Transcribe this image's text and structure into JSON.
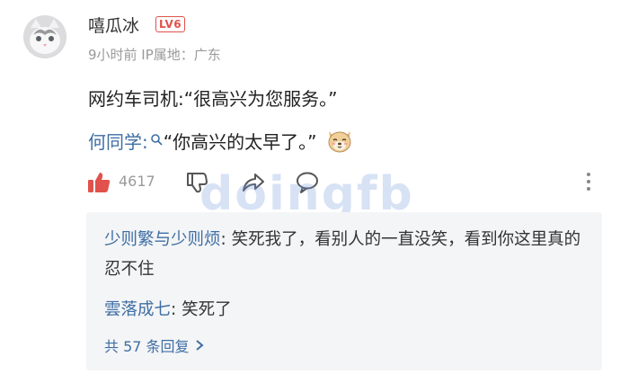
{
  "comment": {
    "username": "嘻瓜冰",
    "level_badge": "LV6",
    "meta": "9小时前 IP属地：广东",
    "line1": "网约车司机:“很高兴为您服务。”",
    "line2_mention": "何同学:",
    "line2_text": "“你高兴的太早了。”",
    "likes": "4617"
  },
  "watermark": "doingfb",
  "replies": {
    "reply1_name": "少则繁与少则烦",
    "reply1_text": ": 笑死我了，看别人的一直没笑，看到你这里真的忍不住",
    "reply2_name": "雲落成七",
    "reply2_text": ": 笑死了",
    "more_label": "共 57 条回复"
  },
  "icons": {
    "avatar": "cat-avatar",
    "like": "thumbs-up-icon",
    "dislike": "thumbs-down-icon",
    "share": "share-icon",
    "comment": "comment-icon",
    "more": "more-vertical-icon"
  },
  "colors": {
    "accent_red": "#e0524b",
    "link_blue": "#3e6ea3",
    "meta_gray": "#9a9a9a",
    "reply_bg": "#f4f5f7"
  }
}
